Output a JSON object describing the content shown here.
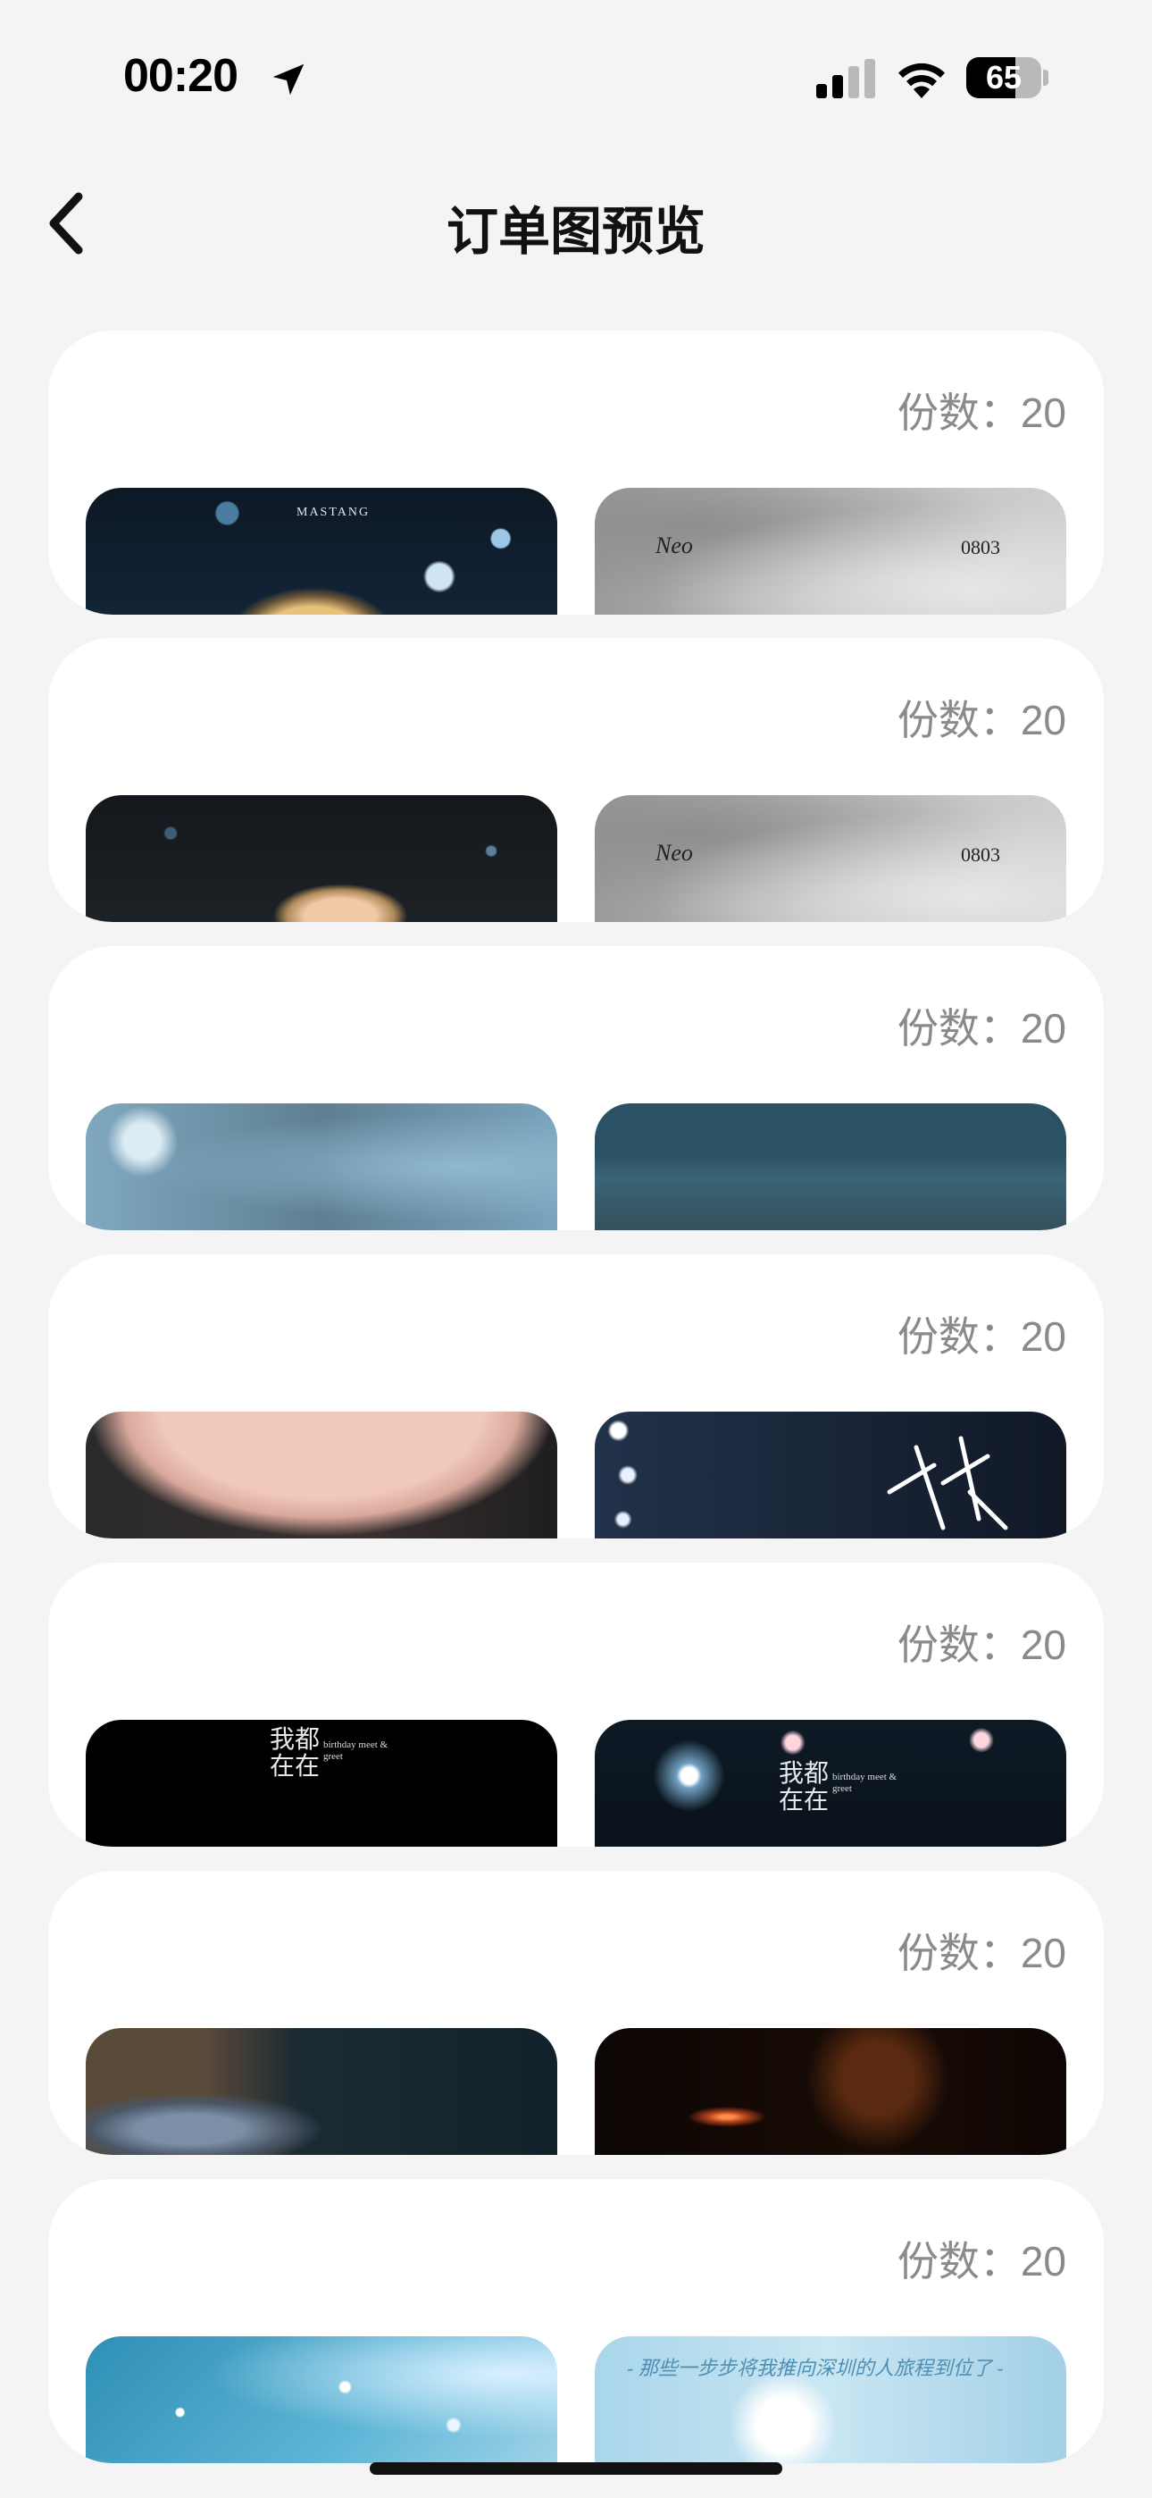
{
  "status_bar": {
    "time": "00:20",
    "battery_level": 65,
    "battery_text": "65"
  },
  "header": {
    "title": "订单图预览"
  },
  "quantity_label": "份数：",
  "orders": [
    {
      "quantity": "20",
      "images": [
        {
          "name": "concert-photo-blue-bokeh",
          "caption": "MASTANG",
          "caption2": ""
        },
        {
          "name": "gray-texture-card",
          "caption": "Neo",
          "caption2": "0803"
        }
      ]
    },
    {
      "quantity": "20",
      "images": [
        {
          "name": "concert-photo-dark-portrait",
          "caption": "",
          "caption2": ""
        },
        {
          "name": "gray-texture-card",
          "caption": "Neo",
          "caption2": "0803"
        }
      ]
    },
    {
      "quantity": "20",
      "images": [
        {
          "name": "blue-blurred-photo",
          "caption": "",
          "caption2": ""
        },
        {
          "name": "teal-concrete-photo",
          "caption": "",
          "caption2": ""
        }
      ]
    },
    {
      "quantity": "20",
      "images": [
        {
          "name": "skin-closeup-photo",
          "caption": "",
          "caption2": ""
        },
        {
          "name": "stage-lights-calligraphy",
          "caption": "",
          "caption2": ""
        }
      ]
    },
    {
      "quantity": "20",
      "images": [
        {
          "name": "black-birthday-card",
          "caption": "我都在在",
          "caption2": "birthday meet & greet"
        },
        {
          "name": "stage-birthday-card",
          "caption": "我都在在",
          "caption2": "birthday meet & greet"
        }
      ]
    },
    {
      "quantity": "20",
      "images": [
        {
          "name": "denim-jacket-photo",
          "caption": "",
          "caption2": ""
        },
        {
          "name": "orange-spark-photo",
          "caption": "",
          "caption2": ""
        }
      ]
    },
    {
      "quantity": "20",
      "images": [
        {
          "name": "blue-glitter-photo",
          "caption": "",
          "caption2": ""
        },
        {
          "name": "light-blue-handwriting",
          "caption": "- 那些一步步将我推向深圳的人旅程到位了 -",
          "caption2": ""
        }
      ]
    }
  ],
  "colors": {
    "background": "#f4f4f4",
    "card": "#ffffff",
    "quantity_text": "#8a8a8a"
  }
}
